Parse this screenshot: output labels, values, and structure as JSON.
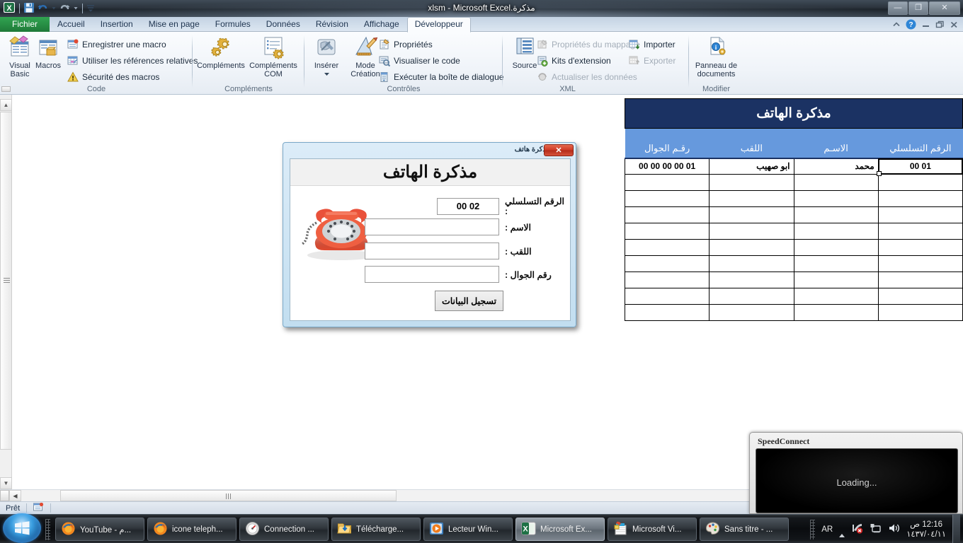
{
  "window": {
    "title": "مذكرة.xlsm  -  Microsoft Excel",
    "minimize": "—",
    "maximize": "❐",
    "close": "✕"
  },
  "quick_access": {
    "excel_icon": "excel-icon",
    "save": "save-icon",
    "undo": "undo-icon",
    "redo": "redo-icon",
    "customize": "customize-icon"
  },
  "ribbon": {
    "tabs": [
      {
        "label": "Fichier",
        "type": "file"
      },
      {
        "label": "Accueil",
        "type": "normal"
      },
      {
        "label": "Insertion",
        "type": "normal"
      },
      {
        "label": "Mise en page",
        "type": "normal"
      },
      {
        "label": "Formules",
        "type": "normal"
      },
      {
        "label": "Données",
        "type": "normal"
      },
      {
        "label": "Révision",
        "type": "normal"
      },
      {
        "label": "Affichage",
        "type": "normal"
      },
      {
        "label": "Développeur",
        "type": "active"
      }
    ],
    "groups": [
      {
        "title": "Code",
        "big_buttons": [
          {
            "label": "Visual Basic",
            "icon": "visual-basic-icon"
          },
          {
            "label": "Macros",
            "icon": "macros-icon"
          }
        ],
        "small_buttons": [
          {
            "label": "Enregistrer une macro",
            "icon": "record-macro-icon",
            "disabled": false
          },
          {
            "label": "Utiliser les références relatives",
            "icon": "relative-references-icon",
            "disabled": false
          },
          {
            "label": "Sécurité des macros",
            "icon": "macro-security-icon",
            "disabled": false
          }
        ]
      },
      {
        "title": "Compléments",
        "big_buttons": [
          {
            "label": "Compléments",
            "icon": "addins-icon"
          },
          {
            "label": "Compléments COM",
            "icon": "com-addins-icon"
          }
        ],
        "small_buttons": []
      },
      {
        "title": "Contrôles",
        "big_buttons": [
          {
            "label": "Insérer",
            "icon": "insert-control-icon"
          },
          {
            "label": "Mode Création",
            "icon": "design-mode-icon"
          }
        ],
        "small_buttons": [
          {
            "label": "Propriétés",
            "icon": "properties-icon",
            "disabled": false
          },
          {
            "label": "Visualiser le code",
            "icon": "view-code-icon",
            "disabled": false
          },
          {
            "label": "Exécuter la boîte de dialogue",
            "icon": "run-dialog-icon",
            "disabled": false
          }
        ]
      },
      {
        "title": "XML",
        "big_buttons": [
          {
            "label": "Source",
            "icon": "xml-source-icon"
          }
        ],
        "small_buttons": [
          {
            "label": "Propriétés du mappage",
            "icon": "map-properties-icon",
            "disabled": true
          },
          {
            "label": "Kits d'extension",
            "icon": "expansion-packs-icon",
            "disabled": false
          },
          {
            "label": "Actualiser les données",
            "icon": "refresh-data-icon",
            "disabled": true
          },
          {
            "label": "Importer",
            "icon": "import-icon",
            "disabled": false
          },
          {
            "label": "Exporter",
            "icon": "export-icon",
            "disabled": true
          }
        ]
      },
      {
        "title": "Modifier",
        "big_buttons": [
          {
            "label": "Panneau de documents",
            "icon": "document-panel-icon"
          }
        ],
        "small_buttons": []
      }
    ],
    "right_icons": [
      "minimize-ribbon-icon",
      "help-icon",
      "restore-window-icon",
      "maximize-window-icon",
      "close-window-icon"
    ]
  },
  "sheet": {
    "table_title": "مذكرة  الهاتف",
    "headers": [
      "الرقم التسلسلي",
      "الاسـم",
      "اللقب",
      "رقـم الجوال"
    ],
    "rows": [
      {
        "serial": "01 00",
        "name": "محمد",
        "surname": "ابو صهيب",
        "mobile": "01 00 00 00 00",
        "selected": true
      },
      {
        "serial": "",
        "name": "",
        "surname": "",
        "mobile": "",
        "selected": false
      },
      {
        "serial": "",
        "name": "",
        "surname": "",
        "mobile": "",
        "selected": false
      },
      {
        "serial": "",
        "name": "",
        "surname": "",
        "mobile": "",
        "selected": false
      },
      {
        "serial": "",
        "name": "",
        "surname": "",
        "mobile": "",
        "selected": false
      },
      {
        "serial": "",
        "name": "",
        "surname": "",
        "mobile": "",
        "selected": false
      },
      {
        "serial": "",
        "name": "",
        "surname": "",
        "mobile": "",
        "selected": false
      },
      {
        "serial": "",
        "name": "",
        "surname": "",
        "mobile": "",
        "selected": false
      },
      {
        "serial": "",
        "name": "",
        "surname": "",
        "mobile": "",
        "selected": false
      },
      {
        "serial": "",
        "name": "",
        "surname": "",
        "mobile": "",
        "selected": false
      }
    ],
    "colors": {
      "title_bg": "#1b3263",
      "header_bg": "#6699dd",
      "grid_line": "#000000"
    }
  },
  "status_bar": {
    "state": "Prêt",
    "macro_icon": "record-macro-status-icon"
  },
  "userform": {
    "title": "مذكرة هاتف",
    "close_label": "✕",
    "header": "مذكرة الهاتف",
    "phone_icon": "telephone-icon",
    "fields": [
      {
        "label": "الرقم التسلسلي :",
        "value": "02 00",
        "name": "serial-number"
      },
      {
        "label": "الاسم :",
        "value": "",
        "name": "first-name"
      },
      {
        "label": "اللقب :",
        "value": "",
        "name": "surname"
      },
      {
        "label": "رقم الجوال :",
        "value": "",
        "name": "mobile-number"
      }
    ],
    "submit_label": "تسجيل البيانات"
  },
  "speedconnect": {
    "title": "SpeedConnect",
    "screen_text": "Loading..."
  },
  "taskbar": {
    "start_icon": "windows-start-icon",
    "tasks": [
      {
        "label": "YouTube - م...",
        "icon": "firefox-icon",
        "active": false
      },
      {
        "label": "icone teleph...",
        "icon": "firefox-icon",
        "active": false
      },
      {
        "label": "Connection ...",
        "icon": "speedconnect-icon",
        "active": false
      },
      {
        "label": "Télécharge...",
        "icon": "folder-download-icon",
        "active": false
      },
      {
        "label": "Lecteur Win...",
        "icon": "windows-media-player-icon",
        "active": false
      },
      {
        "label": "Microsoft Ex...",
        "icon": "excel-icon",
        "active": true
      },
      {
        "label": "Microsoft Vi...",
        "icon": "visual-basic-editor-icon",
        "active": false
      },
      {
        "label": "Sans titre - ...",
        "icon": "paint-icon",
        "active": false
      }
    ],
    "tray": {
      "language": "AR",
      "show_hidden_icon": "chevron-up-icon",
      "network_icon": "network-error-icon",
      "action_center_icon": "action-center-icon",
      "volume_icon": "volume-icon",
      "time": "12:16 ص",
      "date": "١٤٣٧/٠٤/١١"
    }
  }
}
